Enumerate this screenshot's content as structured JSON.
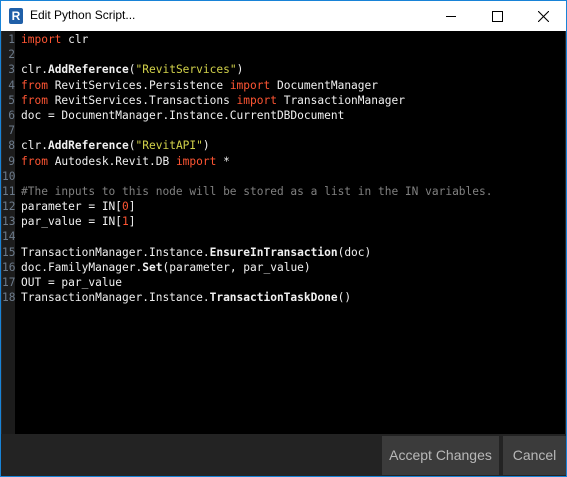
{
  "window": {
    "title": "Edit Python Script...",
    "app_icon_letter": "R"
  },
  "buttons": {
    "accept_label": "Accept Changes",
    "cancel_label": "Cancel"
  },
  "colors": {
    "keyword": "#ff5533",
    "string": "#d2d24a",
    "comment": "#808080",
    "editor_bg": "#000000"
  },
  "code": {
    "lines": [
      [
        {
          "t": "import",
          "c": "keyword"
        },
        {
          "t": " clr"
        }
      ],
      [],
      [
        {
          "t": "clr."
        },
        {
          "t": "AddReference",
          "c": "bold"
        },
        {
          "t": "("
        },
        {
          "t": "\"RevitServices\"",
          "c": "string"
        },
        {
          "t": ")"
        }
      ],
      [
        {
          "t": "from",
          "c": "keyword"
        },
        {
          "t": " RevitServices.Persistence "
        },
        {
          "t": "import",
          "c": "keyword"
        },
        {
          "t": " DocumentManager"
        }
      ],
      [
        {
          "t": "from",
          "c": "keyword"
        },
        {
          "t": " RevitServices.Transactions "
        },
        {
          "t": "import",
          "c": "keyword"
        },
        {
          "t": " TransactionManager"
        }
      ],
      [
        {
          "t": "doc = DocumentManager.Instance.CurrentDBDocument"
        }
      ],
      [],
      [
        {
          "t": "clr."
        },
        {
          "t": "AddReference",
          "c": "bold"
        },
        {
          "t": "("
        },
        {
          "t": "\"RevitAPI\"",
          "c": "string"
        },
        {
          "t": ")"
        }
      ],
      [
        {
          "t": "from",
          "c": "keyword"
        },
        {
          "t": " Autodesk.Revit.DB "
        },
        {
          "t": "import",
          "c": "keyword"
        },
        {
          "t": " *"
        }
      ],
      [],
      [
        {
          "t": "#The inputs to this node will be stored as a list in the IN variables.",
          "c": "comment"
        }
      ],
      [
        {
          "t": "parameter = IN["
        },
        {
          "t": "0",
          "c": "number"
        },
        {
          "t": "]"
        }
      ],
      [
        {
          "t": "par_value = IN["
        },
        {
          "t": "1",
          "c": "number"
        },
        {
          "t": "]"
        }
      ],
      [],
      [
        {
          "t": "TransactionManager.Instance."
        },
        {
          "t": "EnsureInTransaction",
          "c": "bold"
        },
        {
          "t": "(doc)"
        }
      ],
      [
        {
          "t": "doc.FamilyManager."
        },
        {
          "t": "Set",
          "c": "bold"
        },
        {
          "t": "(parameter, par_value)"
        }
      ],
      [
        {
          "t": "OUT = par_value"
        }
      ],
      [
        {
          "t": "TransactionManager.Instance."
        },
        {
          "t": "TransactionTaskDone",
          "c": "bold"
        },
        {
          "t": "()"
        }
      ]
    ]
  }
}
